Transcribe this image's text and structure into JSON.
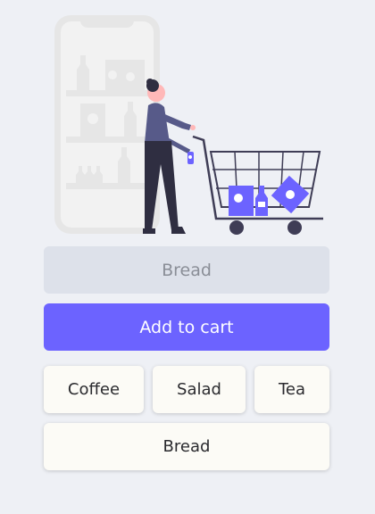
{
  "colors": {
    "accent": "#6c63ff",
    "background": "#eef0f5",
    "input_background": "#dde1ea",
    "chip_background": "#fcfbf6",
    "illustration_gray": "#e6e6e6",
    "figure_dark": "#2f2e41"
  },
  "illustration": {
    "icon": "shopping-cart-illustration"
  },
  "item_input": {
    "placeholder": "Bread"
  },
  "add_button": {
    "label": "Add to cart"
  },
  "suggestions": [
    {
      "label": "Coffee"
    },
    {
      "label": "Salad"
    },
    {
      "label": "Tea"
    },
    {
      "label": "Bread"
    }
  ]
}
